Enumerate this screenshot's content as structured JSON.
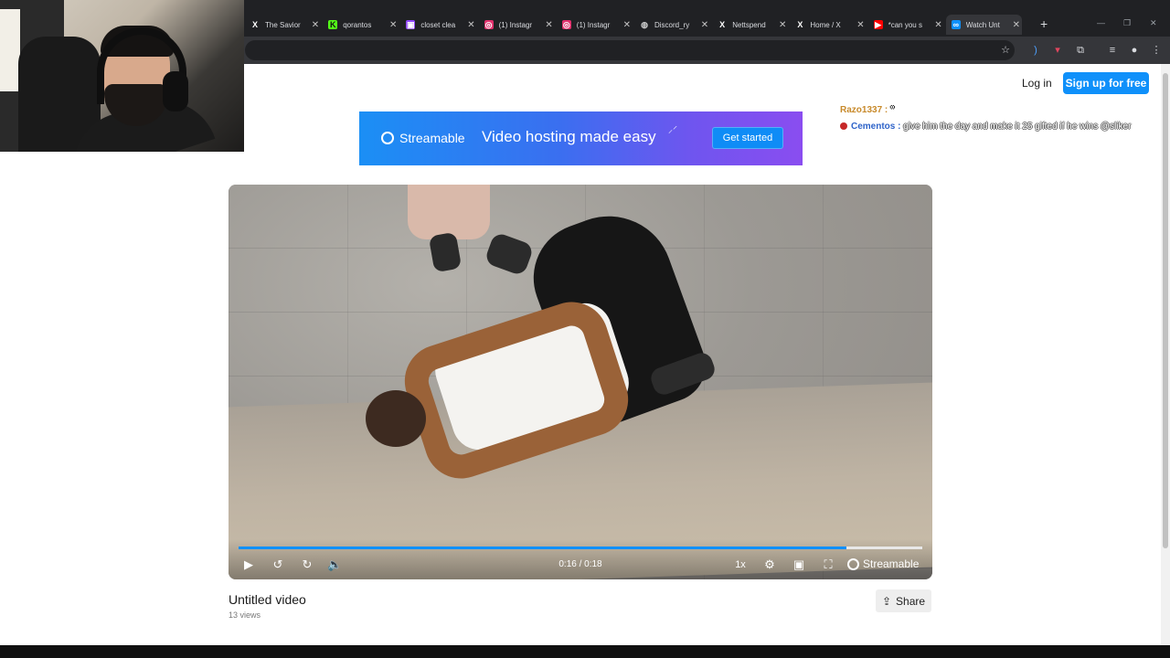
{
  "browser": {
    "tabs": [
      {
        "label": "The Savior",
        "icon": "x-icon",
        "icon_text": "X",
        "icon_color": "#ffffff",
        "icon_bg": "transparent",
        "active": false
      },
      {
        "label": "qorantos",
        "icon": "kick-icon",
        "icon_text": "K",
        "icon_color": "#111111",
        "icon_bg": "#53fc18",
        "active": false
      },
      {
        "label": "closet clea",
        "icon": "twitch-icon",
        "icon_text": "▣",
        "icon_color": "#ffffff",
        "icon_bg": "#9146ff",
        "active": false
      },
      {
        "label": "(1) Instagr",
        "icon": "instagram-icon",
        "icon_text": "◎",
        "icon_color": "#ffffff",
        "icon_bg": "#e1306c",
        "active": false
      },
      {
        "label": "(1) Instagr",
        "icon": "instagram-icon",
        "icon_text": "◎",
        "icon_color": "#ffffff",
        "icon_bg": "#e1306c",
        "active": false
      },
      {
        "label": "Discord_ry",
        "icon": "globe-icon",
        "icon_text": "◍",
        "icon_color": "#cfcfcf",
        "icon_bg": "transparent",
        "active": false
      },
      {
        "label": "Nettspend",
        "icon": "x-icon",
        "icon_text": "X",
        "icon_color": "#ffffff",
        "icon_bg": "transparent",
        "active": false
      },
      {
        "label": "Home / X",
        "icon": "x-icon",
        "icon_text": "X",
        "icon_color": "#ffffff",
        "icon_bg": "transparent",
        "active": false
      },
      {
        "label": "*can you s",
        "icon": "youtube-icon",
        "icon_text": "▶",
        "icon_color": "#ffffff",
        "icon_bg": "#ff0000",
        "active": false
      },
      {
        "label": "Watch Unt",
        "icon": "streamable-icon",
        "icon_text": "∞",
        "icon_color": "#ffffff",
        "icon_bg": "#0f90fa",
        "active": true
      }
    ],
    "new_tab": "+",
    "close_glyph": "✕"
  },
  "header": {
    "login_label": "Log in",
    "signup_label": "Sign up for free"
  },
  "chat": {
    "line1_user": "Razo1337 :",
    "line1_msg": "\"",
    "line2_user": "Cementos :",
    "line2_msg": "give him the day and make it 25 gifted if he wins @sliker"
  },
  "banner": {
    "brand": "Streamable",
    "tagline": "Video hosting made easy",
    "cta": "Get started"
  },
  "player": {
    "time": "0:16 / 0:18",
    "progress": 0.889,
    "speed": "1x",
    "brand": "Streamable",
    "accent": "#0f90fa"
  },
  "video_info": {
    "title": "Untitled video",
    "views": "13 views",
    "share_label": "Share"
  }
}
